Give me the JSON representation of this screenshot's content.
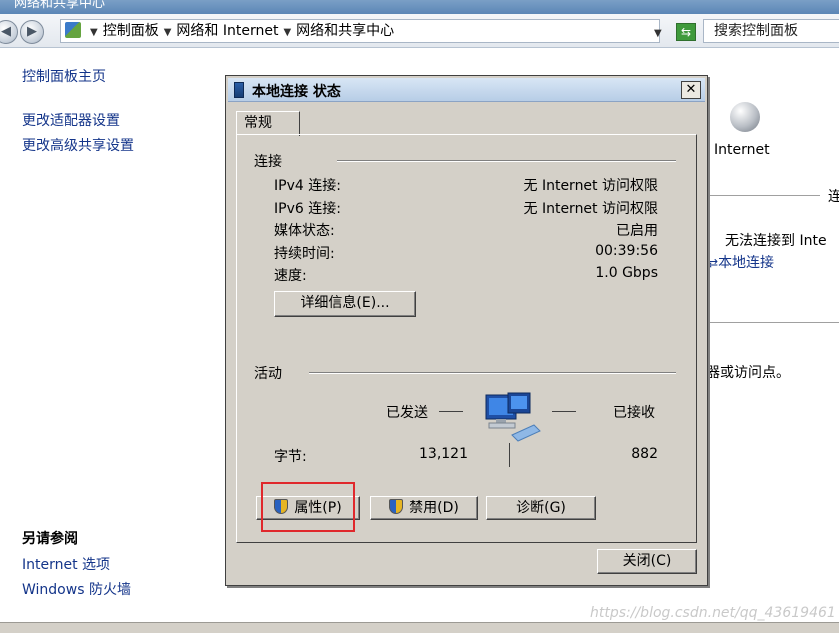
{
  "window": {
    "title": "网络和共享中心"
  },
  "addressbar": {
    "breadcrumb": [
      "控制面板",
      "网络和 Internet",
      "网络和共享中心"
    ],
    "search_placeholder": "搜索控制面板"
  },
  "leftpane": {
    "home": "控制面板主页",
    "links": [
      "更改适配器设置",
      "更改高级共享设置"
    ],
    "see_also_title": "另请参阅",
    "see_also": [
      "Internet 选项",
      "Windows 防火墙"
    ]
  },
  "bg_right": {
    "internet_label": "Internet",
    "connect_partial": "连",
    "no_connect": "无法连接到 Inte",
    "local_link": "本地连接",
    "router_partial": "器或访问点。"
  },
  "dialog": {
    "title": "本地连接 状态",
    "close_glyph": "✕",
    "tab": "常规",
    "connection": {
      "label": "连接",
      "rows": [
        {
          "label": "IPv4 连接:",
          "value": "无 Internet 访问权限"
        },
        {
          "label": "IPv6 连接:",
          "value": "无 Internet 访问权限"
        },
        {
          "label": "媒体状态:",
          "value": "已启用"
        },
        {
          "label": "持续时间:",
          "value": "00:39:56"
        },
        {
          "label": "速度:",
          "value": "1.0 Gbps"
        }
      ],
      "details_button": "详细信息(E)..."
    },
    "activity": {
      "label": "活动",
      "sent_label": "已发送",
      "received_label": "已接收",
      "bytes_label": "字节:",
      "bytes_sent": "13,121",
      "bytes_received": "882"
    },
    "buttons": {
      "properties": "属性(P)",
      "disable": "禁用(D)",
      "diagnose": "诊断(G)",
      "close": "关闭(C)"
    }
  },
  "watermark": "https://blog.csdn.net/qq_43619461",
  "colors": {
    "link": "#14358a",
    "highlight_box": "#e0282c",
    "dialog_face": "#d4d0c8"
  }
}
